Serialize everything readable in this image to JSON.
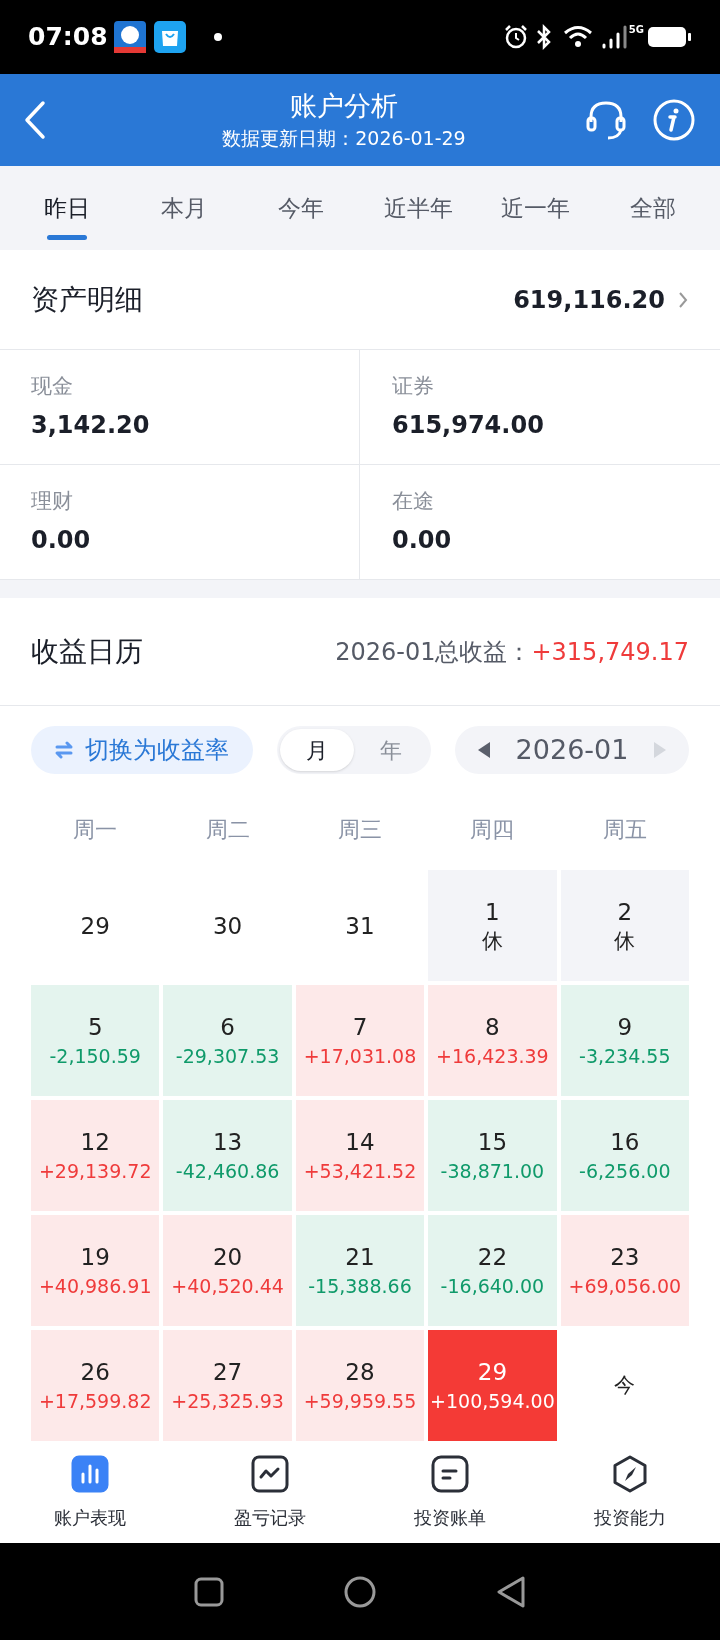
{
  "status_bar": {
    "time": "07:08",
    "network": "5G"
  },
  "header": {
    "title": "账户分析",
    "subtitle": "数据更新日期：2026-01-29"
  },
  "tabs": [
    {
      "label": "昨日",
      "selected": true
    },
    {
      "label": "本月",
      "selected": false
    },
    {
      "label": "今年",
      "selected": false
    },
    {
      "label": "近半年",
      "selected": false
    },
    {
      "label": "近一年",
      "selected": false
    },
    {
      "label": "全部",
      "selected": false
    }
  ],
  "assets": {
    "title": "资产明细",
    "total": "619,116.20",
    "items": [
      {
        "label": "现金",
        "value": "3,142.20"
      },
      {
        "label": "证券",
        "value": "615,974.00"
      },
      {
        "label": "理财",
        "value": "0.00"
      },
      {
        "label": "在途",
        "value": "0.00"
      }
    ]
  },
  "calendar": {
    "title": "收益日历",
    "summary_label": "2026-01总收益：",
    "summary_value": "+315,749.17",
    "switch_button": "切换为收益率",
    "modes": [
      {
        "label": "月",
        "selected": true
      },
      {
        "label": "年",
        "selected": false
      }
    ],
    "month": "2026-01",
    "weekdays": [
      "周一",
      "周二",
      "周三",
      "周四",
      "周五"
    ],
    "cells": [
      {
        "kind": "plain",
        "day": "29"
      },
      {
        "kind": "plain",
        "day": "30"
      },
      {
        "kind": "plain",
        "day": "31"
      },
      {
        "kind": "holiday",
        "day": "1",
        "note": "休"
      },
      {
        "kind": "holiday",
        "day": "2",
        "note": "休"
      },
      {
        "kind": "loss",
        "day": "5",
        "value": "-2,150.59"
      },
      {
        "kind": "loss",
        "day": "6",
        "value": "-29,307.53"
      },
      {
        "kind": "gain",
        "day": "7",
        "value": "+17,031.08"
      },
      {
        "kind": "gain",
        "day": "8",
        "value": "+16,423.39"
      },
      {
        "kind": "loss",
        "day": "9",
        "value": "-3,234.55"
      },
      {
        "kind": "gain",
        "day": "12",
        "value": "+29,139.72"
      },
      {
        "kind": "loss",
        "day": "13",
        "value": "-42,460.86"
      },
      {
        "kind": "gain",
        "day": "14",
        "value": "+53,421.52"
      },
      {
        "kind": "loss",
        "day": "15",
        "value": "-38,871.00"
      },
      {
        "kind": "loss",
        "day": "16",
        "value": "-6,256.00"
      },
      {
        "kind": "gain",
        "day": "19",
        "value": "+40,986.91"
      },
      {
        "kind": "gain",
        "day": "20",
        "value": "+40,520.44"
      },
      {
        "kind": "loss",
        "day": "21",
        "value": "-15,388.66"
      },
      {
        "kind": "loss",
        "day": "22",
        "value": "-16,640.00"
      },
      {
        "kind": "gain",
        "day": "23",
        "value": "+69,056.00"
      },
      {
        "kind": "gain",
        "day": "26",
        "value": "+17,599.82"
      },
      {
        "kind": "gain",
        "day": "27",
        "value": "+25,325.93"
      },
      {
        "kind": "gain",
        "day": "28",
        "value": "+59,959.55"
      },
      {
        "kind": "latest",
        "day": "29",
        "value": "+100,594.00"
      },
      {
        "kind": "today",
        "day": "今"
      }
    ]
  },
  "bottom_nav": [
    {
      "label": "账户表现",
      "selected": true
    },
    {
      "label": "盈亏记录",
      "selected": false
    },
    {
      "label": "投资账单",
      "selected": false
    },
    {
      "label": "投资能力",
      "selected": false
    }
  ]
}
